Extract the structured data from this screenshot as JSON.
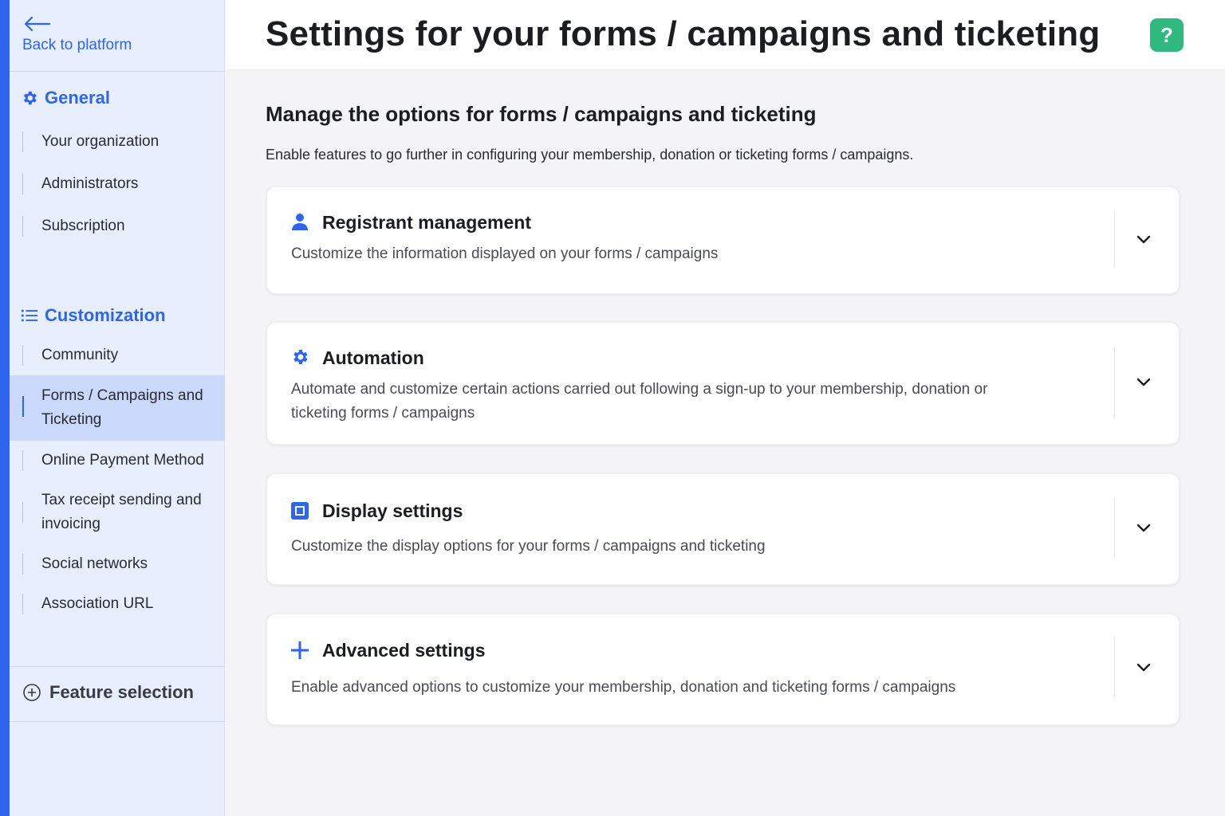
{
  "sidebar": {
    "back_label": "Back to platform",
    "general": {
      "label": "General",
      "items": [
        "Your organization",
        "Administrators",
        "Subscription"
      ]
    },
    "customization": {
      "label": "Customization",
      "items": [
        "Community",
        "Forms / Campaigns and Ticketing",
        "Online Payment Method",
        "Tax receipt sending and invoicing",
        "Social networks",
        "Association URL"
      ],
      "active_item": "Forms / Campaigns and Ticketing"
    },
    "feature_selection_label": "Feature selection"
  },
  "header": {
    "title": "Settings for your forms / campaigns and ticketing",
    "help_label": "?"
  },
  "main": {
    "title": "Manage the options for forms / campaigns and ticketing",
    "description": "Enable features to go further in configuring your membership, donation or ticketing forms / campaigns.",
    "cards": [
      {
        "icon": "user-icon",
        "title": "Registrant management",
        "description": "Customize the information displayed on your forms / campaigns"
      },
      {
        "icon": "gear-icon",
        "title": "Automation",
        "description": "Automate and customize certain actions carried out following a sign-up to your membership, donation or ticketing forms / campaigns"
      },
      {
        "icon": "square-icon",
        "title": "Display settings",
        "description": "Customize the display options for your forms / campaigns and ticketing"
      },
      {
        "icon": "plus-icon",
        "title": "Advanced settings",
        "description": "Enable advanced options to customize your membership, donation and ticketing forms / campaigns"
      }
    ]
  },
  "colors": {
    "accent": "#2f64ee",
    "help": "#2fb97e",
    "sidebar_bg": "#e7eefe",
    "active_bg": "#c9d8fb"
  }
}
